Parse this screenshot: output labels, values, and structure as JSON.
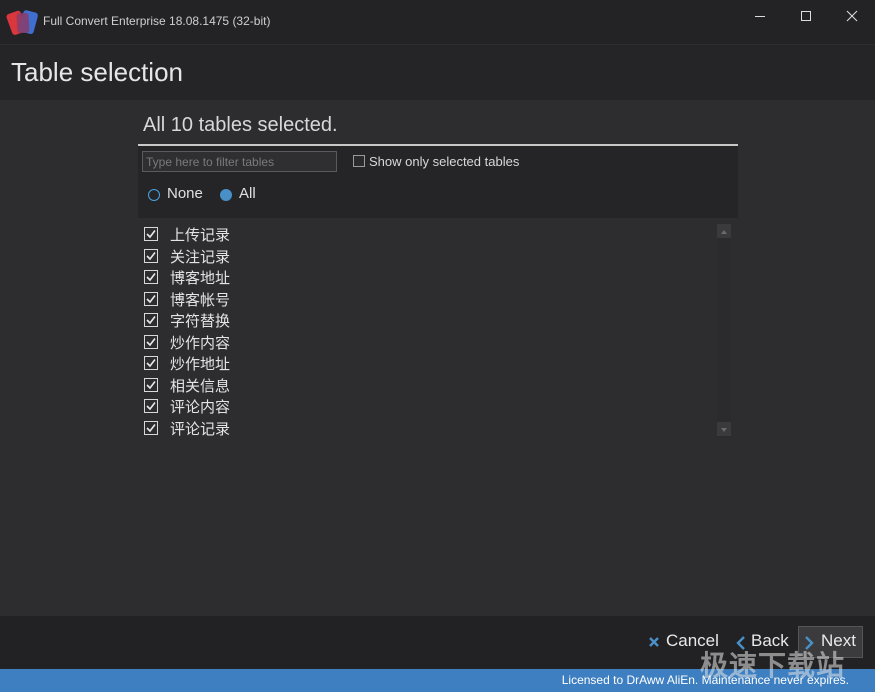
{
  "window": {
    "title": "Full Convert Enterprise 18.08.1475 (32-bit)",
    "controls": [
      "minimize",
      "maximize",
      "close"
    ]
  },
  "page": {
    "title": "Table selection"
  },
  "selection": {
    "summary": "All 10 tables selected.",
    "filter_placeholder": "Type here to filter tables",
    "filter_value": "",
    "show_only_selected_label": "Show only selected tables",
    "show_only_selected_checked": false,
    "radio_none_label": "None",
    "radio_all_label": "All",
    "radio_selected": "All"
  },
  "tables": [
    {
      "name": "上传记录",
      "checked": true
    },
    {
      "name": "关注记录",
      "checked": true
    },
    {
      "name": "博客地址",
      "checked": true
    },
    {
      "name": "博客帐号",
      "checked": true
    },
    {
      "name": "字符替换",
      "checked": true
    },
    {
      "name": "炒作内容",
      "checked": true
    },
    {
      "name": "炒作地址",
      "checked": true
    },
    {
      "name": "相关信息",
      "checked": true
    },
    {
      "name": "评论内容",
      "checked": true
    },
    {
      "name": "评论记录",
      "checked": true
    }
  ],
  "footer": {
    "cancel_label": "Cancel",
    "back_label": "Back",
    "next_label": "Next"
  },
  "status": {
    "license_text": "Licensed to DrAww AliEn. Maintenance never expires."
  },
  "watermark": {
    "text": "极速下载站"
  },
  "colors": {
    "background": "#2d2d30",
    "titlebar": "#232325",
    "accent": "#4a90c8",
    "status_bar": "#3d7fc0"
  },
  "icons": {
    "app": "app-logo-icon",
    "cancel": "x-icon",
    "back": "chevron-left-icon",
    "next": "chevron-right-icon"
  }
}
